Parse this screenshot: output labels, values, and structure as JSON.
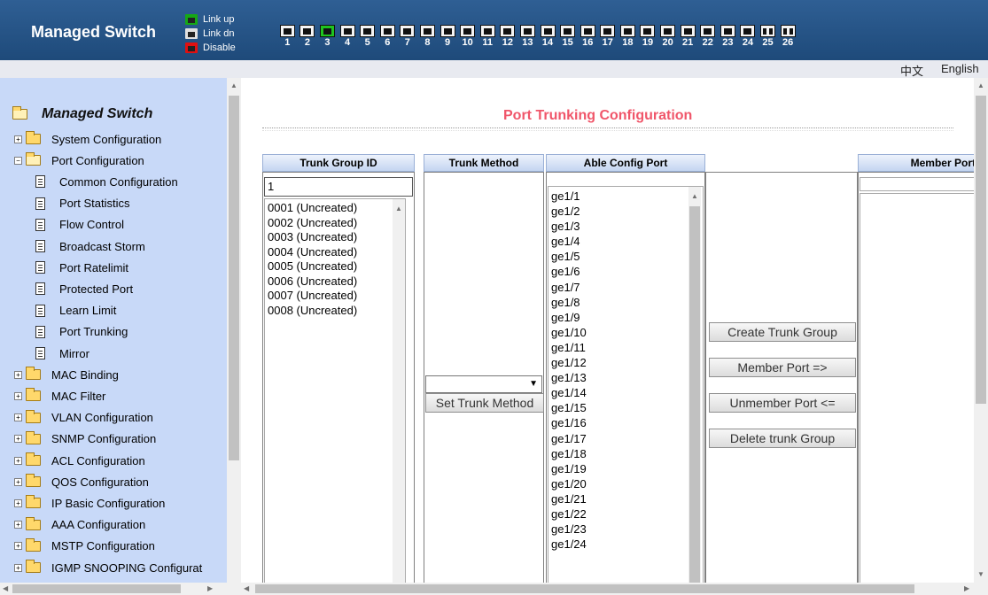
{
  "header": {
    "brand": "Managed Switch",
    "legend": [
      {
        "label": "Link up",
        "state": "up"
      },
      {
        "label": "Link dn",
        "state": "dn"
      },
      {
        "label": "Disable",
        "state": "dis"
      }
    ],
    "ports": [
      {
        "num": "1",
        "state": "dn"
      },
      {
        "num": "2",
        "state": "dn"
      },
      {
        "num": "3",
        "state": "up"
      },
      {
        "num": "4",
        "state": "dn"
      },
      {
        "num": "5",
        "state": "dn"
      },
      {
        "num": "6",
        "state": "dn"
      },
      {
        "num": "7",
        "state": "dn"
      },
      {
        "num": "8",
        "state": "dn"
      },
      {
        "num": "9",
        "state": "dn"
      },
      {
        "num": "10",
        "state": "dn"
      },
      {
        "num": "11",
        "state": "dn"
      },
      {
        "num": "12",
        "state": "dn"
      },
      {
        "num": "13",
        "state": "dn"
      },
      {
        "num": "14",
        "state": "dn"
      },
      {
        "num": "15",
        "state": "dn"
      },
      {
        "num": "16",
        "state": "dn"
      },
      {
        "num": "17",
        "state": "dn"
      },
      {
        "num": "18",
        "state": "dn"
      },
      {
        "num": "19",
        "state": "dn"
      },
      {
        "num": "20",
        "state": "dn"
      },
      {
        "num": "21",
        "state": "dn"
      },
      {
        "num": "22",
        "state": "dn"
      },
      {
        "num": "23",
        "state": "dn"
      },
      {
        "num": "24",
        "state": "dn"
      },
      {
        "num": "25",
        "state": "sfp"
      },
      {
        "num": "26",
        "state": "sfp"
      }
    ]
  },
  "languages": {
    "chinese": "中文",
    "english": "English"
  },
  "sidebar": {
    "root": "Managed Switch",
    "items": [
      {
        "label": "System Configuration",
        "kind": "folder"
      },
      {
        "label": "Port Configuration",
        "kind": "folder-open"
      },
      {
        "label": "Common Configuration",
        "kind": "doc"
      },
      {
        "label": "Port Statistics",
        "kind": "doc"
      },
      {
        "label": "Flow Control",
        "kind": "doc"
      },
      {
        "label": "Broadcast Storm",
        "kind": "doc"
      },
      {
        "label": "Port Ratelimit",
        "kind": "doc"
      },
      {
        "label": "Protected Port",
        "kind": "doc"
      },
      {
        "label": "Learn Limit",
        "kind": "doc"
      },
      {
        "label": "Port Trunking",
        "kind": "doc"
      },
      {
        "label": "Mirror",
        "kind": "doc"
      },
      {
        "label": "MAC Binding",
        "kind": "folder"
      },
      {
        "label": "MAC Filter",
        "kind": "folder"
      },
      {
        "label": "VLAN Configuration",
        "kind": "folder"
      },
      {
        "label": "SNMP Configuration",
        "kind": "folder"
      },
      {
        "label": "ACL Configuration",
        "kind": "folder"
      },
      {
        "label": "QOS Configuration",
        "kind": "folder"
      },
      {
        "label": "IP Basic Configuration",
        "kind": "folder"
      },
      {
        "label": "AAA Configuration",
        "kind": "folder"
      },
      {
        "label": "MSTP Configuration",
        "kind": "folder"
      },
      {
        "label": "IGMP SNOOPING Configurat",
        "kind": "folder"
      }
    ]
  },
  "main": {
    "title": "Port Trunking Configuration",
    "columns": {
      "trunk_group_id": "Trunk Group ID",
      "trunk_method": "Trunk Method",
      "able_config_port": "Able Config Port",
      "member_port": "Member Port"
    },
    "trunk_id_value": "1",
    "trunk_groups": [
      "0001 (Uncreated)",
      "0002 (Uncreated)",
      "0003 (Uncreated)",
      "0004 (Uncreated)",
      "0005 (Uncreated)",
      "0006 (Uncreated)",
      "0007 (Uncreated)",
      "0008 (Uncreated)"
    ],
    "method_selected": "",
    "buttons": {
      "set_trunk_method": "Set Trunk Method",
      "create_trunk_group": "Create Trunk Group",
      "member_port": "Member Port =>",
      "unmember_port": "Unmember Port <=",
      "delete_trunk_group": "Delete trunk Group"
    },
    "able_ports": [
      "ge1/1",
      "ge1/2",
      "ge1/3",
      "ge1/4",
      "ge1/5",
      "ge1/6",
      "ge1/7",
      "ge1/8",
      "ge1/9",
      "ge1/10",
      "ge1/11",
      "ge1/12",
      "ge1/13",
      "ge1/14",
      "ge1/15",
      "ge1/16",
      "ge1/17",
      "ge1/18",
      "ge1/19",
      "ge1/20",
      "ge1/21",
      "ge1/22",
      "ge1/23",
      "ge1/24"
    ]
  }
}
